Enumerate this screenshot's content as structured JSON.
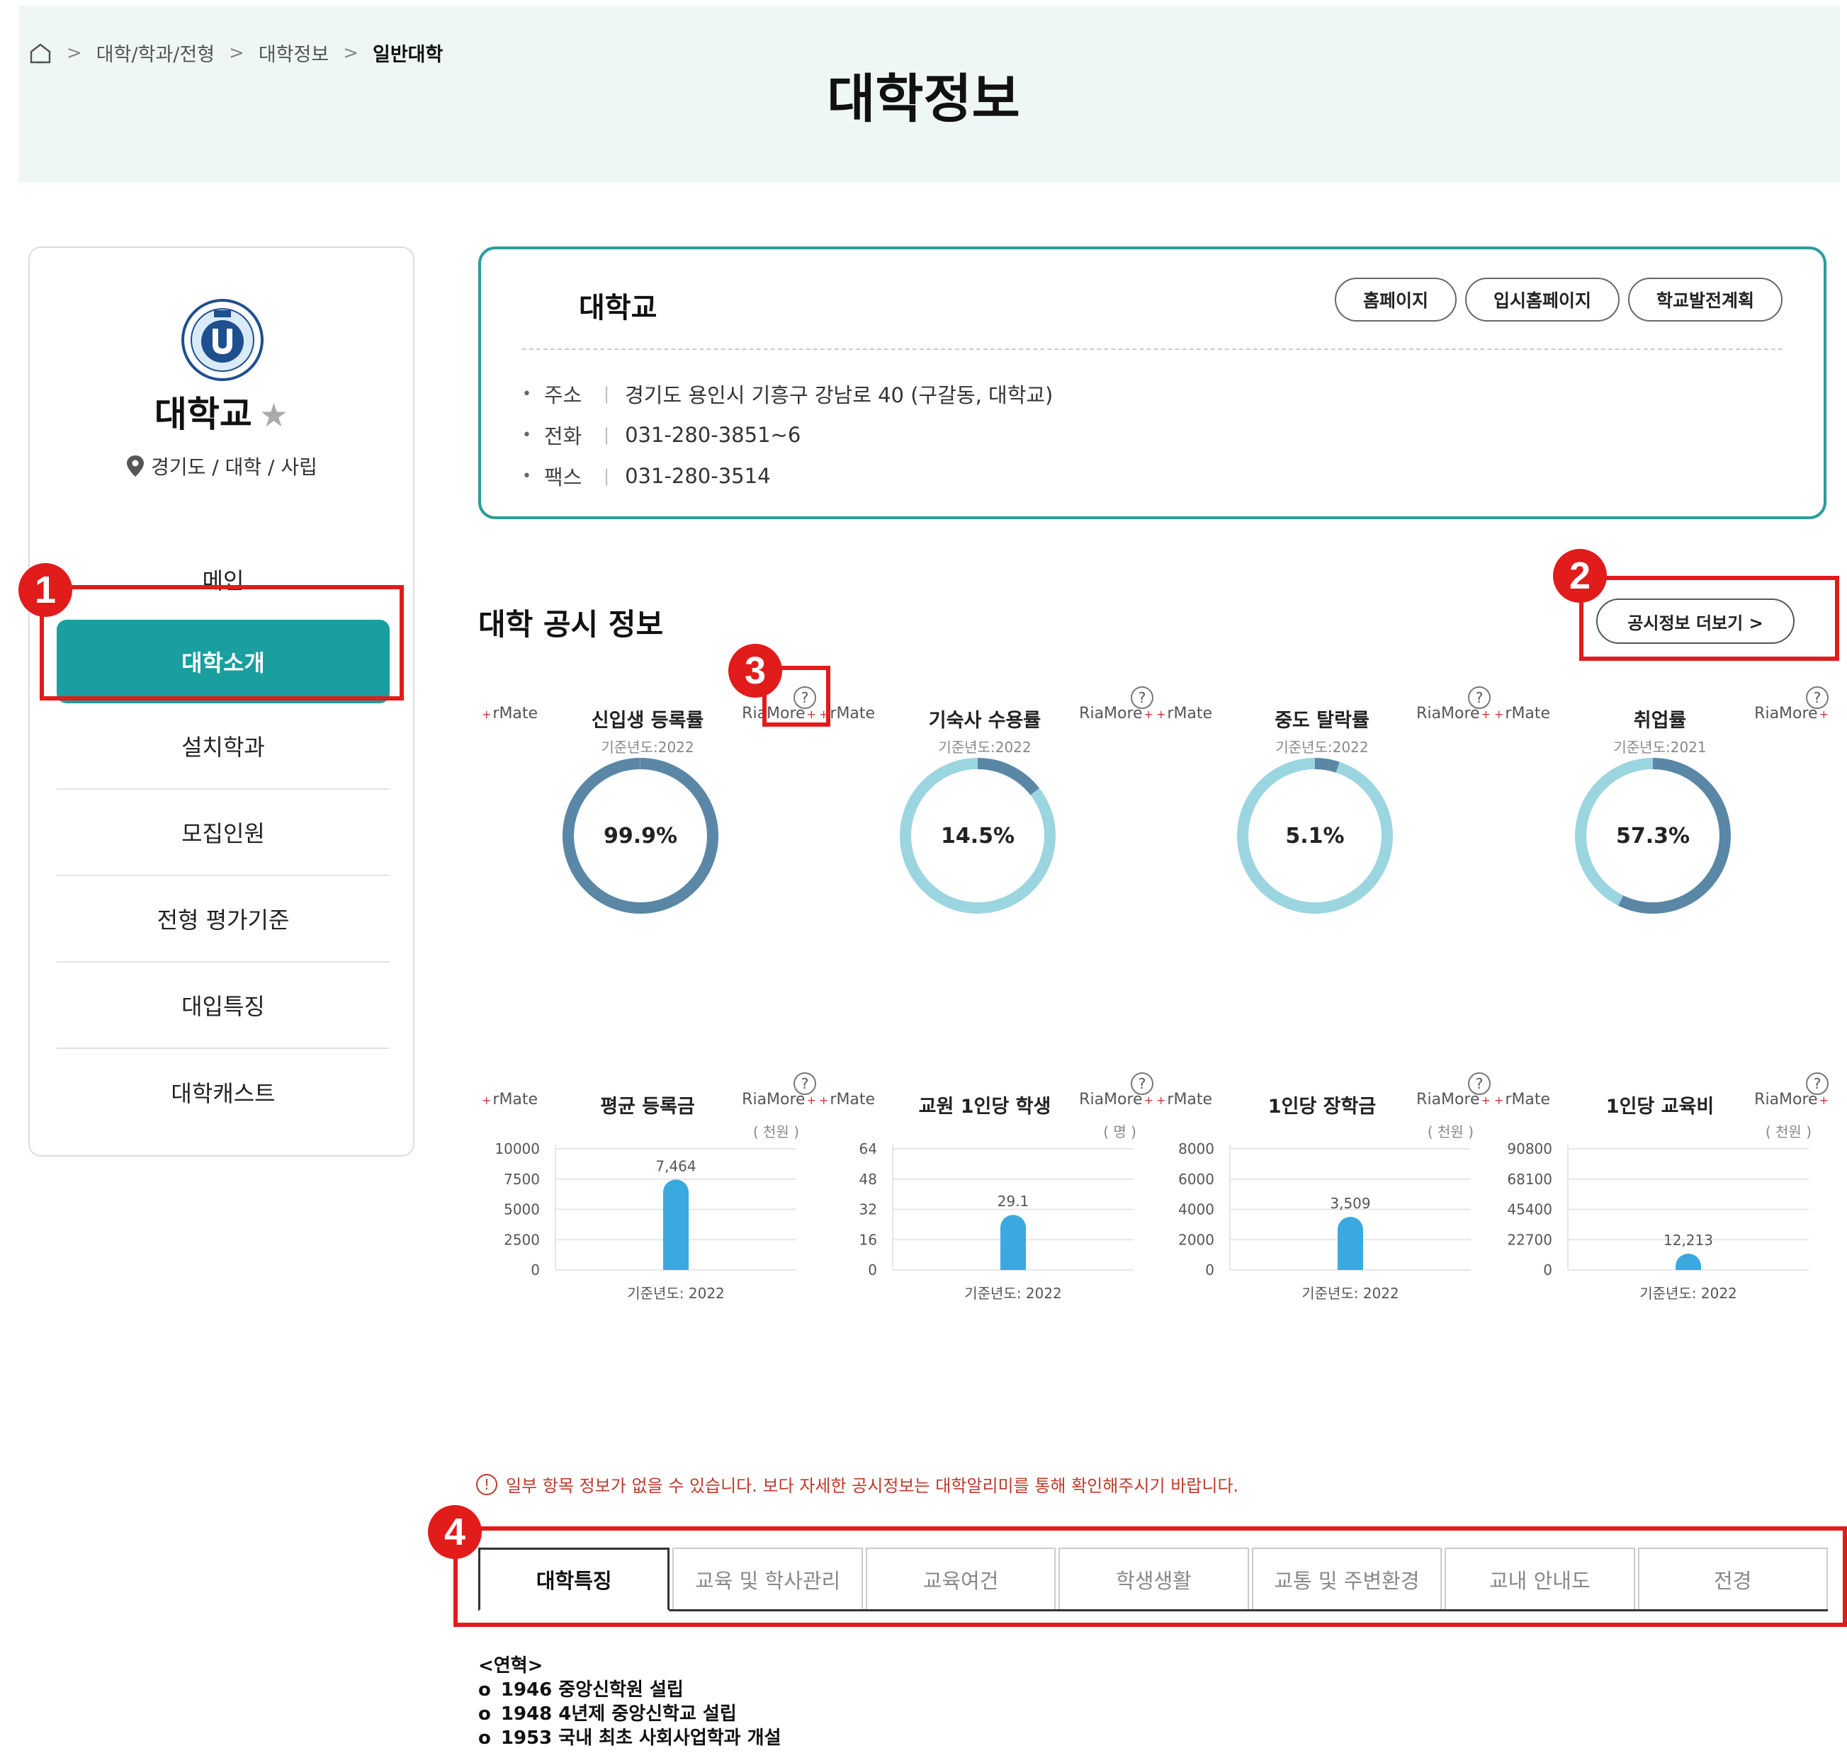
{
  "breadcrumb": {
    "items": [
      "대학/학과/전형",
      "대학정보"
    ],
    "current": "일반대학"
  },
  "page_title": "대학정보",
  "sidebar": {
    "uni_name": "대학교",
    "location": "경기도 / 대학 / 사립",
    "menu": [
      "메인",
      "대학소개",
      "설치학과",
      "모집인원",
      "전형 평가기준",
      "대입특징",
      "대학캐스트"
    ]
  },
  "info": {
    "name": "대학교",
    "buttons": [
      "홈페이지",
      "입시홈페이지",
      "학교발전계획"
    ],
    "rows": [
      {
        "label": "주소",
        "value": "경기도 용인시 기흥구 강남로 40 (구갈동,      대학교)"
      },
      {
        "label": "전화",
        "value": "031-280-3851~6"
      },
      {
        "label": "팩스",
        "value": "031-280-3514"
      }
    ]
  },
  "disclosure": {
    "title": "대학 공시 정보",
    "more": "공시정보 더보기 >",
    "tag_left": "rMate",
    "tag_right": "RiaMore",
    "help": "?",
    "donuts": [
      {
        "title": "신입생 등록률",
        "year": "기준년도:2022",
        "value": 99.9,
        "label": "99.9%"
      },
      {
        "title": "기숙사 수용률",
        "year": "기준년도:2022",
        "value": 14.5,
        "label": "14.5%"
      },
      {
        "title": "중도 탈락률",
        "year": "기준년도:2022",
        "value": 5.1,
        "label": "5.1%"
      },
      {
        "title": "취업률",
        "year": "기준년도:2021",
        "value": 57.3,
        "label": "57.3%"
      }
    ],
    "notice": "일부 항목 정보가 없을 수 있습니다. 보다 자세한 공시정보는 대학알리미를 통해 확인해주시기 바랍니다."
  },
  "chart_data": [
    {
      "type": "bar",
      "title": "평균 등록금",
      "unit": "( 천원 )",
      "categories": [
        "기준년도: 2022"
      ],
      "values": [
        7464
      ],
      "value_labels": [
        "7,464"
      ],
      "yticks": [
        "10000",
        "7500",
        "5000",
        "2500",
        "0"
      ],
      "ylim": [
        0,
        10000
      ]
    },
    {
      "type": "bar",
      "title": "교원 1인당 학생",
      "unit": "( 명 )",
      "categories": [
        "기준년도: 2022"
      ],
      "values": [
        29.1
      ],
      "value_labels": [
        "29.1"
      ],
      "yticks": [
        "64",
        "48",
        "32",
        "16",
        "0"
      ],
      "ylim": [
        0,
        64
      ]
    },
    {
      "type": "bar",
      "title": "1인당 장학금",
      "unit": "( 천원 )",
      "categories": [
        "기준년도: 2022"
      ],
      "values": [
        3509
      ],
      "value_labels": [
        "3,509"
      ],
      "yticks": [
        "8000",
        "6000",
        "4000",
        "2000",
        "0"
      ],
      "ylim": [
        0,
        8000
      ]
    },
    {
      "type": "bar",
      "title": "1인당 교육비",
      "unit": "( 천원 )",
      "categories": [
        "기준년도: 2022"
      ],
      "values": [
        12213
      ],
      "value_labels": [
        "12,213"
      ],
      "yticks": [
        "90800",
        "68100",
        "45400",
        "22700",
        "0"
      ],
      "ylim": [
        0,
        90800
      ]
    }
  ],
  "tabs": [
    "대학특징",
    "교육 및 학사관리",
    "교육여건",
    "학생생활",
    "교통 및 주변환경",
    "교내 안내도",
    "전경"
  ],
  "history": {
    "title": "<연혁>",
    "items": [
      "1946 중앙신학원 설립",
      "1948 4년제 중앙신학교 설립",
      "1953 국내 최초 사회사업학과 개설"
    ]
  },
  "annotations": [
    "1",
    "2",
    "3",
    "4"
  ],
  "colors": {
    "accent": "#1a9e9f",
    "donut_dark": "#5a87a5",
    "donut_light": "#9bd5e0",
    "bar": "#3aa9e0",
    "annotation": "#e21b1b"
  }
}
